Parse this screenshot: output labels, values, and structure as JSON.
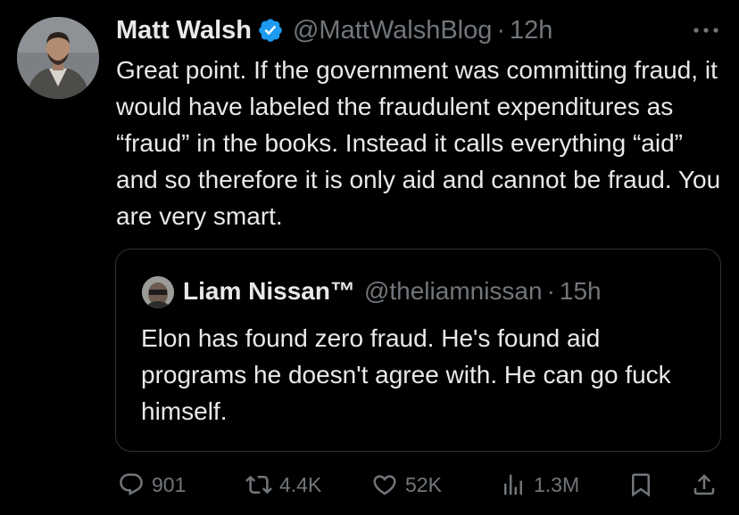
{
  "post": {
    "author_name": "Matt Walsh",
    "author_handle": "@MattWalshBlog",
    "separator": "·",
    "time": "12h",
    "text": "Great point. If the government was committing fraud, it would have labeled the fraudulent expenditures as “fraud” in the books. Instead it calls everything “aid” and so therefore it is only aid and cannot be fraud. You are very smart.",
    "verified_icon": "verified-badge-icon",
    "more_icon": "more-options-icon"
  },
  "quote": {
    "author_name": "Liam Nissan™",
    "author_handle": "@theliamnissan",
    "separator": "·",
    "time": "15h",
    "text": "Elon has found zero fraud. He's found aid programs he doesn't agree with. He can go fuck himself."
  },
  "actions": {
    "replies": "901",
    "reposts": "4.4K",
    "likes": "52K",
    "views": "1.3M",
    "reply_icon": "reply-icon",
    "repost_icon": "repost-icon",
    "like_icon": "heart-icon",
    "views_icon": "views-chart-icon",
    "bookmark_icon": "bookmark-icon",
    "share_icon": "share-icon"
  },
  "colors": {
    "background": "#000000",
    "text_primary": "#e7e9ea",
    "text_secondary": "#71767b",
    "verified_blue": "#1d9bf0",
    "border": "#2f3336"
  }
}
